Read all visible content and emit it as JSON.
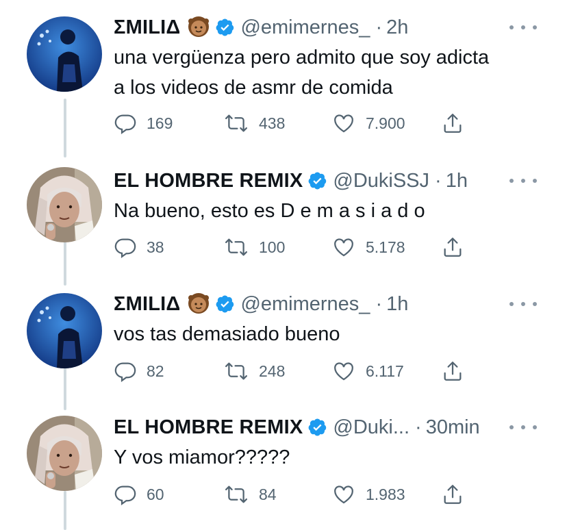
{
  "tweets": [
    {
      "name": "ΣMILIΔ",
      "has_emoji": true,
      "handle": "@emimernes_",
      "dot": "·",
      "time": "2h",
      "text_lines": [
        "una vergüenza pero admito que soy adicta",
        "a los videos de asmr de comida"
      ],
      "replies": "169",
      "retweets": "438",
      "likes": "7.900"
    },
    {
      "name": "EL HOMBRE REMIX",
      "has_emoji": false,
      "handle": "@DukiSSJ",
      "dot": "·",
      "time": "1h",
      "text_lines": [
        "Na bueno, esto es D e m a s i a d o"
      ],
      "replies": "38",
      "retweets": "100",
      "likes": "5.178"
    },
    {
      "name": "ΣMILIΔ",
      "has_emoji": true,
      "handle": "@emimernes_",
      "dot": "·",
      "time": "1h",
      "text_lines": [
        "vos tas demasiado bueno"
      ],
      "replies": "82",
      "retweets": "248",
      "likes": "6.117"
    },
    {
      "name": "EL HOMBRE REMIX",
      "has_emoji": false,
      "handle": "@Duki...",
      "dot": "·",
      "time": "30min",
      "text_lines": [
        "Y vos miamor?????"
      ],
      "replies": "60",
      "retweets": "84",
      "likes": "1.983"
    }
  ],
  "icons": {
    "reply": "reply-icon",
    "retweet": "retweet-icon",
    "like": "heart-icon",
    "share": "share-icon",
    "verified": "verified-badge-icon",
    "more": "more-options-icon"
  },
  "colors": {
    "verified": "#1d9bf0",
    "secondary_text": "#536471",
    "thread_line": "#cfd9de"
  }
}
